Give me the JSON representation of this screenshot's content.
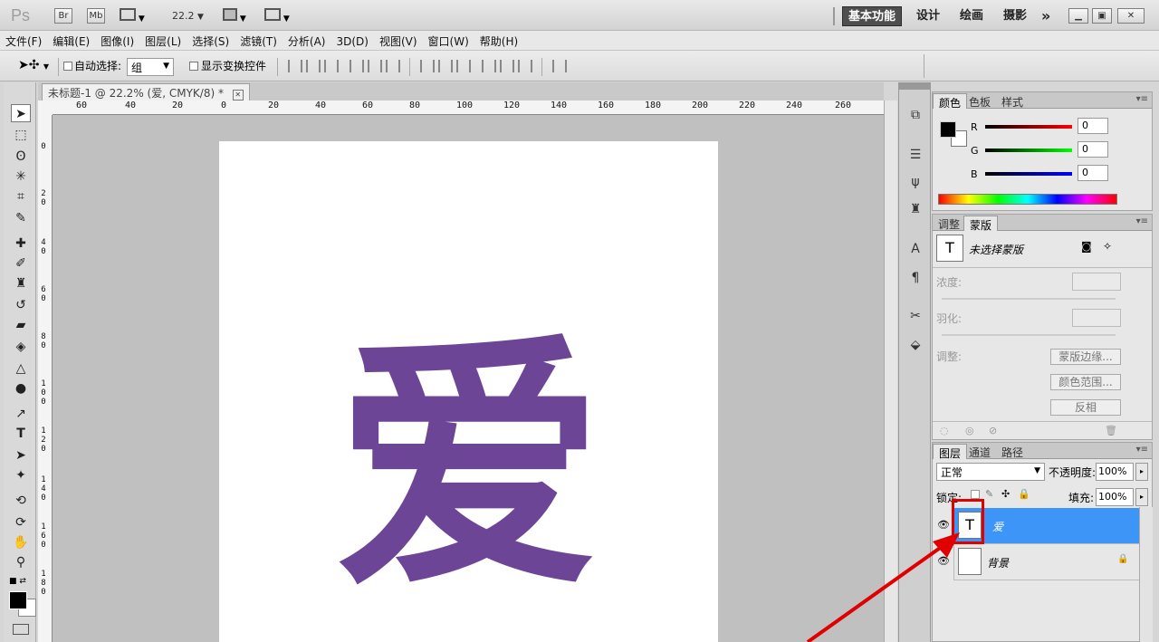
{
  "app": {
    "logo": "Ps",
    "zoom": "22.2"
  },
  "titlebar": {
    "br_label": "Br",
    "mb_label": "Mb",
    "workspaces": [
      {
        "label": "基本功能",
        "active": true
      },
      {
        "label": "设计"
      },
      {
        "label": "绘画"
      },
      {
        "label": "摄影"
      }
    ],
    "more": "»"
  },
  "menu": [
    "文件(F)",
    "编辑(E)",
    "图像(I)",
    "图层(L)",
    "选择(S)",
    "滤镜(T)",
    "分析(A)",
    "3D(D)",
    "视图(V)",
    "窗口(W)",
    "帮助(H)"
  ],
  "options": {
    "auto_select_label": "自动选择:",
    "auto_select_value": "组",
    "show_transform_label": "显示变换控件"
  },
  "document": {
    "tab_title": "未标题-1 @ 22.2% (爱, CMYK/8) *",
    "close": "✕",
    "text_content": "爱",
    "text_color": "#6d4597"
  },
  "ruler": {
    "top_labels": [
      "60",
      "40",
      "20",
      "0",
      "20",
      "40",
      "60",
      "80",
      "100",
      "120",
      "140",
      "160",
      "180",
      "200",
      "220",
      "240",
      "260"
    ],
    "left_labels": [
      "0",
      "2\n0",
      "4\n0",
      "6\n0",
      "8\n0",
      "1\n0\n0",
      "1\n2\n0",
      "1\n4\n0",
      "1\n6\n0",
      "1\n8\n0"
    ]
  },
  "color_panel": {
    "tabs": [
      "颜色",
      "色板",
      "样式"
    ],
    "channels": [
      {
        "label": "R",
        "value": "0",
        "color": "#c00000"
      },
      {
        "label": "G",
        "value": "0",
        "color": "#00b000"
      },
      {
        "label": "B",
        "value": "0",
        "color": "#0000c0"
      }
    ]
  },
  "masks_panel": {
    "tabs": [
      "调整",
      "蒙版"
    ],
    "status": "未选择蒙版",
    "density_label": "浓度:",
    "feather_label": "羽化:",
    "adjust_label": "调整:",
    "buttons": [
      "蒙版边缘...",
      "颜色范围...",
      "反相"
    ]
  },
  "layers_panel": {
    "tabs": [
      "图层",
      "通道",
      "路径"
    ],
    "blend_mode": "正常",
    "opacity_label": "不透明度:",
    "opacity_value": "100%",
    "lock_label": "锁定:",
    "fill_label": "填充:",
    "fill_value": "100%",
    "layers": [
      {
        "name": "爱",
        "type": "text",
        "thumb": "T",
        "selected": true
      },
      {
        "name": "背景",
        "type": "background",
        "selected": false
      }
    ]
  },
  "annotation": {
    "highlight_color": "#e00000"
  }
}
